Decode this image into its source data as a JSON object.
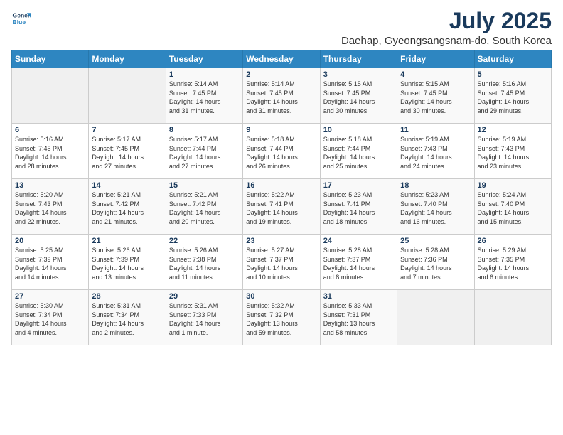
{
  "logo": {
    "line1": "General",
    "line2": "Blue"
  },
  "title": "July 2025",
  "location": "Daehap, Gyeongsangsnam-do, South Korea",
  "days_of_week": [
    "Sunday",
    "Monday",
    "Tuesday",
    "Wednesday",
    "Thursday",
    "Friday",
    "Saturday"
  ],
  "weeks": [
    [
      {
        "day": "",
        "info": ""
      },
      {
        "day": "",
        "info": ""
      },
      {
        "day": "1",
        "info": "Sunrise: 5:14 AM\nSunset: 7:45 PM\nDaylight: 14 hours\nand 31 minutes."
      },
      {
        "day": "2",
        "info": "Sunrise: 5:14 AM\nSunset: 7:45 PM\nDaylight: 14 hours\nand 31 minutes."
      },
      {
        "day": "3",
        "info": "Sunrise: 5:15 AM\nSunset: 7:45 PM\nDaylight: 14 hours\nand 30 minutes."
      },
      {
        "day": "4",
        "info": "Sunrise: 5:15 AM\nSunset: 7:45 PM\nDaylight: 14 hours\nand 30 minutes."
      },
      {
        "day": "5",
        "info": "Sunrise: 5:16 AM\nSunset: 7:45 PM\nDaylight: 14 hours\nand 29 minutes."
      }
    ],
    [
      {
        "day": "6",
        "info": "Sunrise: 5:16 AM\nSunset: 7:45 PM\nDaylight: 14 hours\nand 28 minutes."
      },
      {
        "day": "7",
        "info": "Sunrise: 5:17 AM\nSunset: 7:45 PM\nDaylight: 14 hours\nand 27 minutes."
      },
      {
        "day": "8",
        "info": "Sunrise: 5:17 AM\nSunset: 7:44 PM\nDaylight: 14 hours\nand 27 minutes."
      },
      {
        "day": "9",
        "info": "Sunrise: 5:18 AM\nSunset: 7:44 PM\nDaylight: 14 hours\nand 26 minutes."
      },
      {
        "day": "10",
        "info": "Sunrise: 5:18 AM\nSunset: 7:44 PM\nDaylight: 14 hours\nand 25 minutes."
      },
      {
        "day": "11",
        "info": "Sunrise: 5:19 AM\nSunset: 7:43 PM\nDaylight: 14 hours\nand 24 minutes."
      },
      {
        "day": "12",
        "info": "Sunrise: 5:19 AM\nSunset: 7:43 PM\nDaylight: 14 hours\nand 23 minutes."
      }
    ],
    [
      {
        "day": "13",
        "info": "Sunrise: 5:20 AM\nSunset: 7:43 PM\nDaylight: 14 hours\nand 22 minutes."
      },
      {
        "day": "14",
        "info": "Sunrise: 5:21 AM\nSunset: 7:42 PM\nDaylight: 14 hours\nand 21 minutes."
      },
      {
        "day": "15",
        "info": "Sunrise: 5:21 AM\nSunset: 7:42 PM\nDaylight: 14 hours\nand 20 minutes."
      },
      {
        "day": "16",
        "info": "Sunrise: 5:22 AM\nSunset: 7:41 PM\nDaylight: 14 hours\nand 19 minutes."
      },
      {
        "day": "17",
        "info": "Sunrise: 5:23 AM\nSunset: 7:41 PM\nDaylight: 14 hours\nand 18 minutes."
      },
      {
        "day": "18",
        "info": "Sunrise: 5:23 AM\nSunset: 7:40 PM\nDaylight: 14 hours\nand 16 minutes."
      },
      {
        "day": "19",
        "info": "Sunrise: 5:24 AM\nSunset: 7:40 PM\nDaylight: 14 hours\nand 15 minutes."
      }
    ],
    [
      {
        "day": "20",
        "info": "Sunrise: 5:25 AM\nSunset: 7:39 PM\nDaylight: 14 hours\nand 14 minutes."
      },
      {
        "day": "21",
        "info": "Sunrise: 5:26 AM\nSunset: 7:39 PM\nDaylight: 14 hours\nand 13 minutes."
      },
      {
        "day": "22",
        "info": "Sunrise: 5:26 AM\nSunset: 7:38 PM\nDaylight: 14 hours\nand 11 minutes."
      },
      {
        "day": "23",
        "info": "Sunrise: 5:27 AM\nSunset: 7:37 PM\nDaylight: 14 hours\nand 10 minutes."
      },
      {
        "day": "24",
        "info": "Sunrise: 5:28 AM\nSunset: 7:37 PM\nDaylight: 14 hours\nand 8 minutes."
      },
      {
        "day": "25",
        "info": "Sunrise: 5:28 AM\nSunset: 7:36 PM\nDaylight: 14 hours\nand 7 minutes."
      },
      {
        "day": "26",
        "info": "Sunrise: 5:29 AM\nSunset: 7:35 PM\nDaylight: 14 hours\nand 6 minutes."
      }
    ],
    [
      {
        "day": "27",
        "info": "Sunrise: 5:30 AM\nSunset: 7:34 PM\nDaylight: 14 hours\nand 4 minutes."
      },
      {
        "day": "28",
        "info": "Sunrise: 5:31 AM\nSunset: 7:34 PM\nDaylight: 14 hours\nand 2 minutes."
      },
      {
        "day": "29",
        "info": "Sunrise: 5:31 AM\nSunset: 7:33 PM\nDaylight: 14 hours\nand 1 minute."
      },
      {
        "day": "30",
        "info": "Sunrise: 5:32 AM\nSunset: 7:32 PM\nDaylight: 13 hours\nand 59 minutes."
      },
      {
        "day": "31",
        "info": "Sunrise: 5:33 AM\nSunset: 7:31 PM\nDaylight: 13 hours\nand 58 minutes."
      },
      {
        "day": "",
        "info": ""
      },
      {
        "day": "",
        "info": ""
      }
    ]
  ]
}
